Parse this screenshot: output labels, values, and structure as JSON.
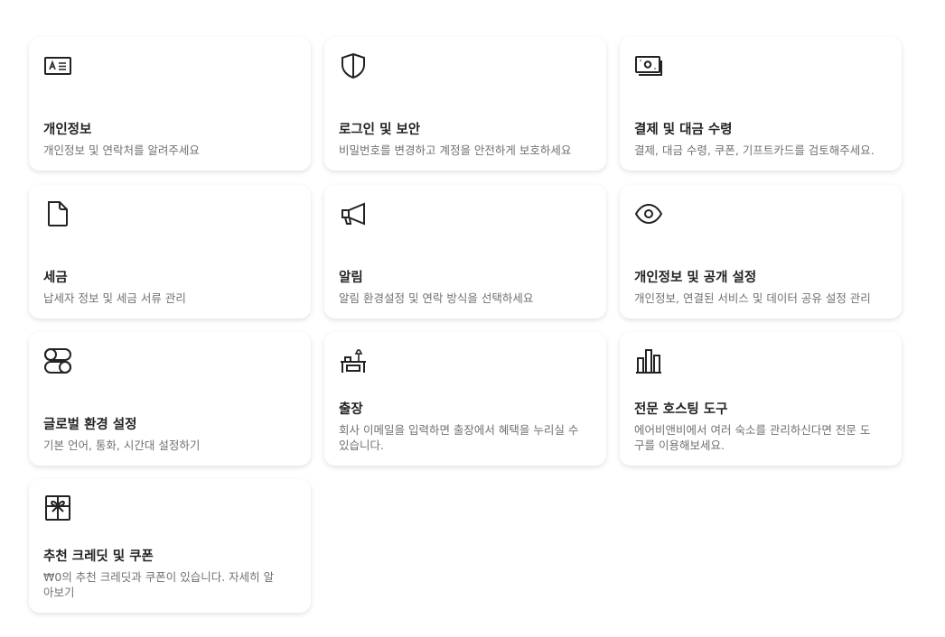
{
  "cards": [
    {
      "title": "개인정보",
      "desc": "개인정보 및 연락처를 알려주세요",
      "icon": "id-card-icon"
    },
    {
      "title": "로그인 및 보안",
      "desc": "비밀번호를 변경하고 계정을 안전하게 보호하세요",
      "icon": "shield-icon"
    },
    {
      "title": "결제 및 대금 수령",
      "desc": "결제, 대금 수령, 쿠폰, 기프트카드를 검토해주세요.",
      "icon": "money-icon"
    },
    {
      "title": "세금",
      "desc": "납세자 정보 및 세금 서류 관리",
      "icon": "document-icon"
    },
    {
      "title": "알림",
      "desc": "알림 환경설정 및 연락 방식을 선택하세요",
      "icon": "megaphone-icon"
    },
    {
      "title": "개인정보 및 공개 설정",
      "desc": "개인정보, 연결된 서비스 및 데이터 공유 설정 관리",
      "icon": "eye-icon"
    },
    {
      "title": "글로벌 환경 설정",
      "desc": "기본 언어, 통화, 시간대 설정하기",
      "icon": "toggles-icon"
    },
    {
      "title": "출장",
      "desc": "회사 이메일을 입력하면 출장에서 혜택을 누리실 수 있습니다.",
      "icon": "desk-icon"
    },
    {
      "title": "전문 호스팅 도구",
      "desc": "에어비앤비에서 여러 숙소를 관리하신다면 전문 도구를 이용해보세요.",
      "icon": "bar-chart-icon"
    },
    {
      "title": "추천 크레딧 및 쿠폰",
      "desc": "₩0의 추천 크레딧과 쿠폰이 있습니다. 자세히 알아보기",
      "icon": "gift-icon"
    }
  ]
}
